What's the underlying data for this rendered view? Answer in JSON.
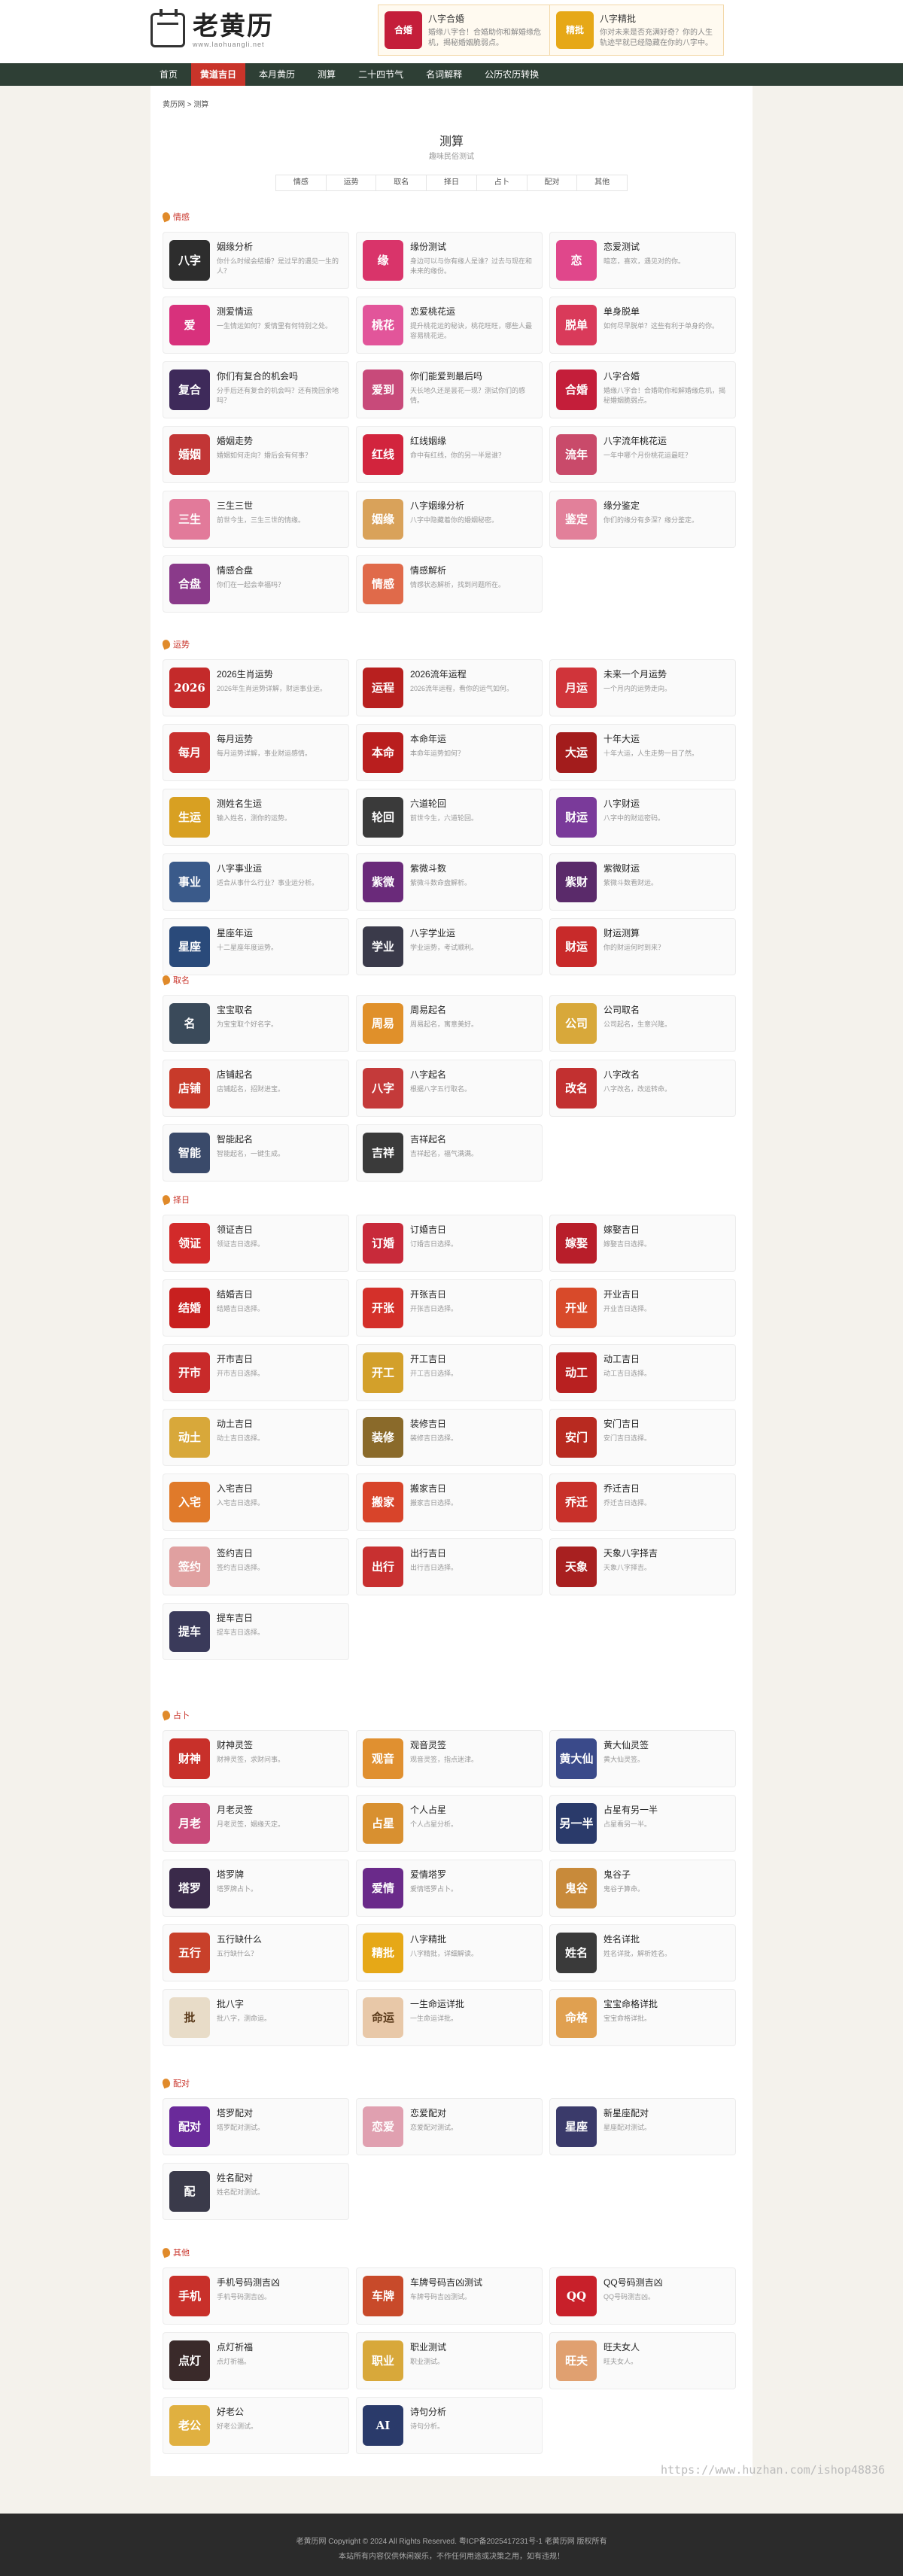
{
  "header": {
    "logo_name": "老黄历",
    "logo_url": "www.laohuangli.net"
  },
  "promos": [
    {
      "title": "八字合婚",
      "desc": "婚缘八字合！合婚助你和解婚缘危机，揭秘婚姻脆弱点。",
      "color": "#c41e3a",
      "icon": "合婚"
    },
    {
      "title": "八字精批",
      "desc": "你对未来是否充满好奇？你的人生轨迹早就已经隐藏在你的八字中。",
      "color": "#e6a817",
      "icon": "精批"
    }
  ],
  "nav": [
    "首页",
    "黄道吉日",
    "本月黄历",
    "测算",
    "二十四节气",
    "名词解释",
    "公历农历转换"
  ],
  "breadcrumb": "黄历网 > 测算",
  "page": {
    "title": "测算",
    "subtitle": "趣味民俗测试"
  },
  "tabs": [
    "情感",
    "运势",
    "取名",
    "择日",
    "占卜",
    "配对",
    "其他"
  ],
  "sections": [
    {
      "title": "情感",
      "cards": [
        {
          "name": "姻缘分析",
          "desc": "你什么时候会结婚？是过早的遇见一生的人？",
          "color": "#2d2d2d",
          "icon": "八字"
        },
        {
          "name": "缘份测试",
          "desc": "身边可以与你有缘人是谁？过去与现在和未来的缘份。",
          "color": "#d9346a",
          "icon": "缘"
        },
        {
          "name": "恋爱测试",
          "desc": "暗恋，喜欢，遇见对的你。",
          "color": "#e0478b",
          "icon": "恋"
        },
        {
          "name": "测爱情运",
          "desc": "一生情运如何？爱情里有何特别之处。",
          "color": "#d8317c",
          "icon": "爱"
        },
        {
          "name": "恋爱桃花运",
          "desc": "提升桃花运的秘诀，桃花旺旺，哪些人最容易桃花运。",
          "color": "#e2559a",
          "icon": "桃花"
        },
        {
          "name": "单身脱单",
          "desc": "如何尽早脱单？这些有利于单身的你。",
          "color": "#d93a5a",
          "icon": "脱单"
        },
        {
          "name": "你们有复合的机会吗",
          "desc": "分手后还有复合的机会吗？还有挽回余地吗？",
          "color": "#3e2a5a",
          "icon": "复合"
        },
        {
          "name": "你们能爱到最后吗",
          "desc": "天长地久还是昙花一现？测试你们的感情。",
          "color": "#c84a7a",
          "icon": "爱到"
        },
        {
          "name": "八字合婚",
          "desc": "婚缘八字合！合婚助你和解婚缘危机，揭秘婚姻脆弱点。",
          "color": "#c41e3a",
          "icon": "合婚"
        },
        {
          "name": "婚姻走势",
          "desc": "婚姻如何走向？婚后会有何事？",
          "color": "#c23636",
          "icon": "婚姻"
        },
        {
          "name": "红线姻缘",
          "desc": "命中有红线，你的另一半是谁？",
          "color": "#d2243d",
          "icon": "红线"
        },
        {
          "name": "八字流年桃花运",
          "desc": "一年中哪个月份桃花运最旺？",
          "color": "#c94a6a",
          "icon": "流年"
        },
        {
          "name": "三生三世",
          "desc": "前世今生，三生三世的情缘。",
          "color": "#e27a9a",
          "icon": "三生"
        },
        {
          "name": "八字姻缘分析",
          "desc": "八字中隐藏着你的婚姻秘密。",
          "color": "#d9a25a",
          "icon": "姻缘"
        },
        {
          "name": "缘分鉴定",
          "desc": "你们的缘分有多深？缘分鉴定。",
          "color": "#e2809a",
          "icon": "鉴定"
        },
        {
          "name": "情感合盘",
          "desc": "你们在一起会幸福吗？",
          "color": "#8a3a8a",
          "icon": "合盘"
        },
        {
          "name": "情感解析",
          "desc": "情感状态解析，找到问题所在。",
          "color": "#e06a4a",
          "icon": "情感"
        }
      ]
    },
    {
      "title": "运势",
      "cards": [
        {
          "name": "2026生肖运势",
          "desc": "2026年生肖运势详解，财运事业运。",
          "color": "#c42a2a",
          "icon": "2026"
        },
        {
          "name": "2026流年运程",
          "desc": "2026流年运程，看你的运气如何。",
          "color": "#b8201f",
          "icon": "运程"
        },
        {
          "name": "未来一个月运势",
          "desc": "一个月内的运势走向。",
          "color": "#d0343a",
          "icon": "月运"
        },
        {
          "name": "每月运势",
          "desc": "每月运势详解，事业财运感情。",
          "color": "#c8302e",
          "icon": "每月"
        },
        {
          "name": "本命年运",
          "desc": "本命年运势如何？",
          "color": "#b91e1e",
          "icon": "本命"
        },
        {
          "name": "十年大运",
          "desc": "十年大运，人生走势一目了然。",
          "color": "#a31c1c",
          "icon": "大运"
        },
        {
          "name": "测姓名生运",
          "desc": "输入姓名，测你的运势。",
          "color": "#d8a022",
          "icon": "生运"
        },
        {
          "name": "六道轮回",
          "desc": "前世今生，六道轮回。",
          "color": "#3a3a3a",
          "icon": "轮回"
        },
        {
          "name": "八字财运",
          "desc": "八字中的财运密码。",
          "color": "#7a3a9a",
          "icon": "财运"
        },
        {
          "name": "八字事业运",
          "desc": "适合从事什么行业？事业运分析。",
          "color": "#3a5a8a",
          "icon": "事业"
        },
        {
          "name": "紫微斗数",
          "desc": "紫微斗数命盘解析。",
          "color": "#6a2a7a",
          "icon": "紫微"
        },
        {
          "name": "紫微财运",
          "desc": "紫微斗数看财运。",
          "color": "#5a2a6a",
          "icon": "紫财"
        },
        {
          "name": "星座年运",
          "desc": "十二星座年度运势。",
          "color": "#2a4a7a",
          "icon": "星座"
        },
        {
          "name": "八字学业运",
          "desc": "学业运势，考试顺利。",
          "color": "#3a3a4a",
          "icon": "学业"
        },
        {
          "name": "财运测算",
          "desc": "你的财运何时到来？",
          "color": "#c82a2a",
          "icon": "财运"
        }
      ]
    },
    {
      "title": "取名",
      "cards": [
        {
          "name": "宝宝取名",
          "desc": "为宝宝取个好名字。",
          "color": "#3a4a5a",
          "icon": "名"
        },
        {
          "name": "周易起名",
          "desc": "周易起名，寓意美好。",
          "color": "#e0902a",
          "icon": "周易"
        },
        {
          "name": "公司取名",
          "desc": "公司起名，生意兴隆。",
          "color": "#d8a83a",
          "icon": "公司"
        },
        {
          "name": "店铺起名",
          "desc": "店铺起名，招财进宝。",
          "color": "#c83a2a",
          "icon": "店铺"
        },
        {
          "name": "八字起名",
          "desc": "根据八字五行取名。",
          "color": "#c43a3a",
          "icon": "八字"
        },
        {
          "name": "八字改名",
          "desc": "八字改名，改运转命。",
          "color": "#c23030",
          "icon": "改名"
        },
        {
          "name": "智能起名",
          "desc": "智能起名，一键生成。",
          "color": "#3a4a6a",
          "icon": "智能"
        },
        {
          "name": "吉祥起名",
          "desc": "吉祥起名，福气满满。",
          "color": "#3a3a3a",
          "icon": "吉祥"
        }
      ]
    },
    {
      "title": "择日",
      "cards": [
        {
          "name": "领证吉日",
          "desc": "领证吉日选择。",
          "color": "#d22a2a",
          "icon": "领证"
        },
        {
          "name": "订婚吉日",
          "desc": "订婚吉日选择。",
          "color": "#c82a3a",
          "icon": "订婚"
        },
        {
          "name": "嫁娶吉日",
          "desc": "嫁娶吉日选择。",
          "color": "#b81e2a",
          "icon": "嫁娶"
        },
        {
          "name": "结婚吉日",
          "desc": "结婚吉日选择。",
          "color": "#c8201f",
          "icon": "结婚"
        },
        {
          "name": "开张吉日",
          "desc": "开张吉日选择。",
          "color": "#d4302a",
          "icon": "开张"
        },
        {
          "name": "开业吉日",
          "desc": "开业吉日选择。",
          "color": "#d84a2a",
          "icon": "开业"
        },
        {
          "name": "开市吉日",
          "desc": "开市吉日选择。",
          "color": "#c82a2a",
          "icon": "开市"
        },
        {
          "name": "开工吉日",
          "desc": "开工吉日选择。",
          "color": "#d3a02a",
          "icon": "开工"
        },
        {
          "name": "动工吉日",
          "desc": "动工吉日选择。",
          "color": "#b82020",
          "icon": "动工"
        },
        {
          "name": "动土吉日",
          "desc": "动土吉日选择。",
          "color": "#d8a83a",
          "icon": "动土"
        },
        {
          "name": "装修吉日",
          "desc": "装修吉日选择。",
          "color": "#8a6a2a",
          "icon": "装修"
        },
        {
          "name": "安门吉日",
          "desc": "安门吉日选择。",
          "color": "#b82a20",
          "icon": "安门"
        },
        {
          "name": "入宅吉日",
          "desc": "入宅吉日选择。",
          "color": "#e07a2a",
          "icon": "入宅"
        },
        {
          "name": "搬家吉日",
          "desc": "搬家吉日选择。",
          "color": "#d8442a",
          "icon": "搬家"
        },
        {
          "name": "乔迁吉日",
          "desc": "乔迁吉日选择。",
          "color": "#c8302a",
          "icon": "乔迁"
        },
        {
          "name": "签约吉日",
          "desc": "签约吉日选择。",
          "color": "#e0a0a0",
          "icon": "签约"
        },
        {
          "name": "出行吉日",
          "desc": "出行吉日选择。",
          "color": "#c83030",
          "icon": "出行"
        },
        {
          "name": "天象八字择吉",
          "desc": "天象八字择吉。",
          "color": "#a82020",
          "icon": "天象"
        },
        {
          "name": "提车吉日",
          "desc": "提车吉日选择。",
          "color": "#3a3a5a",
          "icon": "提车"
        }
      ]
    },
    {
      "title": "占卜",
      "cards": [
        {
          "name": "财神灵签",
          "desc": "财神灵签，求财问事。",
          "color": "#c8302a",
          "icon": "财神"
        },
        {
          "name": "观音灵签",
          "desc": "观音灵签，指点迷津。",
          "color": "#e09030",
          "icon": "观音"
        },
        {
          "name": "黄大仙灵签",
          "desc": "黄大仙灵签。",
          "color": "#3a4a8a",
          "icon": "黄大仙"
        },
        {
          "name": "月老灵签",
          "desc": "月老灵签，姻缘天定。",
          "color": "#c84a7a",
          "icon": "月老"
        },
        {
          "name": "个人占星",
          "desc": "个人占星分析。",
          "color": "#d89030",
          "icon": "占星"
        },
        {
          "name": "占星有另一半",
          "desc": "占星看另一半。",
          "color": "#2a3a6a",
          "icon": "另一半"
        },
        {
          "name": "塔罗牌",
          "desc": "塔罗牌占卜。",
          "color": "#3a2a4a",
          "icon": "塔罗"
        },
        {
          "name": "爱情塔罗",
          "desc": "爱情塔罗占卜。",
          "color": "#6a2a8a",
          "icon": "爱情"
        },
        {
          "name": "鬼谷子",
          "desc": "鬼谷子算命。",
          "color": "#c88a3a",
          "icon": "鬼谷"
        },
        {
          "name": "五行缺什么",
          "desc": "五行缺什么？",
          "color": "#c8402a",
          "icon": "五行"
        },
        {
          "name": "八字精批",
          "desc": "八字精批，详细解读。",
          "color": "#e6a817",
          "icon": "精批"
        },
        {
          "name": "姓名详批",
          "desc": "姓名详批，解析姓名。",
          "color": "#3a3a3a",
          "icon": "姓名"
        },
        {
          "name": "批八字",
          "desc": "批八字，测命运。",
          "color": "#e8dcc8",
          "icon": "批"
        },
        {
          "name": "一生命运详批",
          "desc": "一生命运详批。",
          "color": "#e8c8a8",
          "icon": "命运"
        },
        {
          "name": "宝宝命格详批",
          "desc": "宝宝命格详批。",
          "color": "#e0a050",
          "icon": "命格"
        }
      ]
    },
    {
      "title": "配对",
      "cards": [
        {
          "name": "塔罗配对",
          "desc": "塔罗配对测试。",
          "color": "#6a2a9a",
          "icon": "配对"
        },
        {
          "name": "恋爱配对",
          "desc": "恋爱配对测试。",
          "color": "#e0a0b0",
          "icon": "恋爱"
        },
        {
          "name": "新星座配对",
          "desc": "星座配对测试。",
          "color": "#3a3a6a",
          "icon": "星座"
        },
        {
          "name": "姓名配对",
          "desc": "姓名配对测试。",
          "color": "#3a3a4a",
          "icon": "配"
        }
      ]
    },
    {
      "title": "其他",
      "cards": [
        {
          "name": "手机号码测吉凶",
          "desc": "手机号码测吉凶。",
          "color": "#c8302a",
          "icon": "手机"
        },
        {
          "name": "车牌号码吉凶测试",
          "desc": "车牌号码吉凶测试。",
          "color": "#c84a2a",
          "icon": "车牌"
        },
        {
          "name": "QQ号码测吉凶",
          "desc": "QQ号码测吉凶。",
          "color": "#c8202a",
          "icon": "QQ"
        },
        {
          "name": "点灯祈福",
          "desc": "点灯祈福。",
          "color": "#3a2a2a",
          "icon": "点灯"
        },
        {
          "name": "职业测试",
          "desc": "职业测试。",
          "color": "#d8a83a",
          "icon": "职业"
        },
        {
          "name": "旺夫女人",
          "desc": "旺夫女人。",
          "color": "#e0a070",
          "icon": "旺夫"
        },
        {
          "name": "好老公",
          "desc": "好老公测试。",
          "color": "#e0b040",
          "icon": "老公"
        },
        {
          "name": "诗句分析",
          "desc": "诗句分析。",
          "color": "#2a3a6a",
          "icon": "AI"
        }
      ]
    }
  ],
  "watermark": "https://www.huzhan.com/ishop48836",
  "footer": {
    "line1": "老黄历网 Copyright © 2024 All Rights Reserved.  粤ICP备2025417231号-1  老黄历网  版权所有",
    "line2": "本站所有内容仅供休闲娱乐，不作任何用途或决策之用，如有违规！"
  }
}
